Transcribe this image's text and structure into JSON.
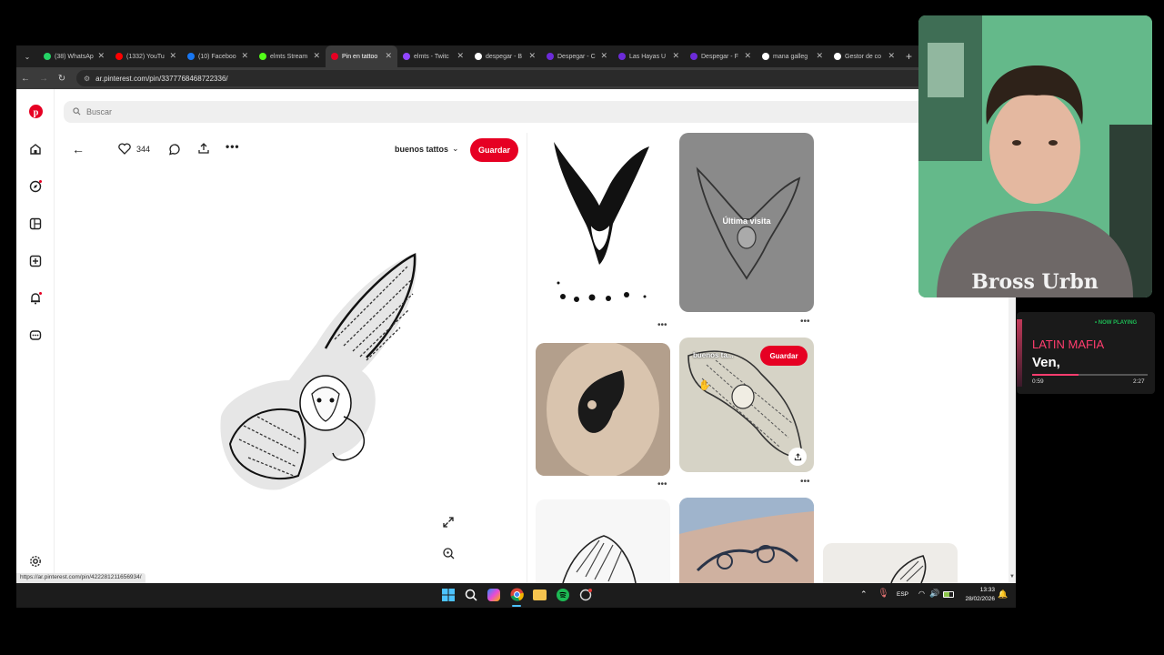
{
  "tabs": [
    {
      "label": "(38) WhatsAp",
      "color": "#25d366"
    },
    {
      "label": "(1332) YouTu",
      "color": "#ff0000"
    },
    {
      "label": "(10) Faceboo",
      "color": "#1877f2"
    },
    {
      "label": "elmts Stream",
      "color": "#53fc18"
    },
    {
      "label": "Pin en tattoo",
      "color": "#e60023",
      "active": true
    },
    {
      "label": "elmts - Twitc",
      "color": "#9146ff"
    },
    {
      "label": "despegar - B",
      "color": "#ffffff"
    },
    {
      "label": "Despegar - C",
      "color": "#6c2bd9"
    },
    {
      "label": "Las Hayas U",
      "color": "#6c2bd9"
    },
    {
      "label": "Despegar - F",
      "color": "#6c2bd9"
    },
    {
      "label": "mana galleg",
      "color": "#ffffff"
    },
    {
      "label": "Gestor de co",
      "color": "#ffffff"
    }
  ],
  "url": "ar.pinterest.com/pin/3377768468722336/",
  "search": {
    "placeholder": "Buscar"
  },
  "pin": {
    "likes": "344",
    "board": "buenos tattos",
    "save_label": "Guardar"
  },
  "grid": {
    "last_visit_label": "Última visita",
    "hover_board": "buenos ta...",
    "hover_save": "Guardar"
  },
  "statusbar_url": "https://ar.pinterest.com/pin/422281211656934/",
  "taskbar": {
    "lang": "ESP",
    "time": "13:33",
    "date": "28/02/2026"
  },
  "nowplaying": {
    "badge": "• NOW PLAYING",
    "artist": "LATIN MAFIA",
    "title": "Ven,",
    "elapsed": "0:59",
    "duration": "2:27",
    "progress": 0.4
  },
  "colors": {
    "pinterest_red": "#e60023",
    "spotify_green": "#1db954"
  }
}
